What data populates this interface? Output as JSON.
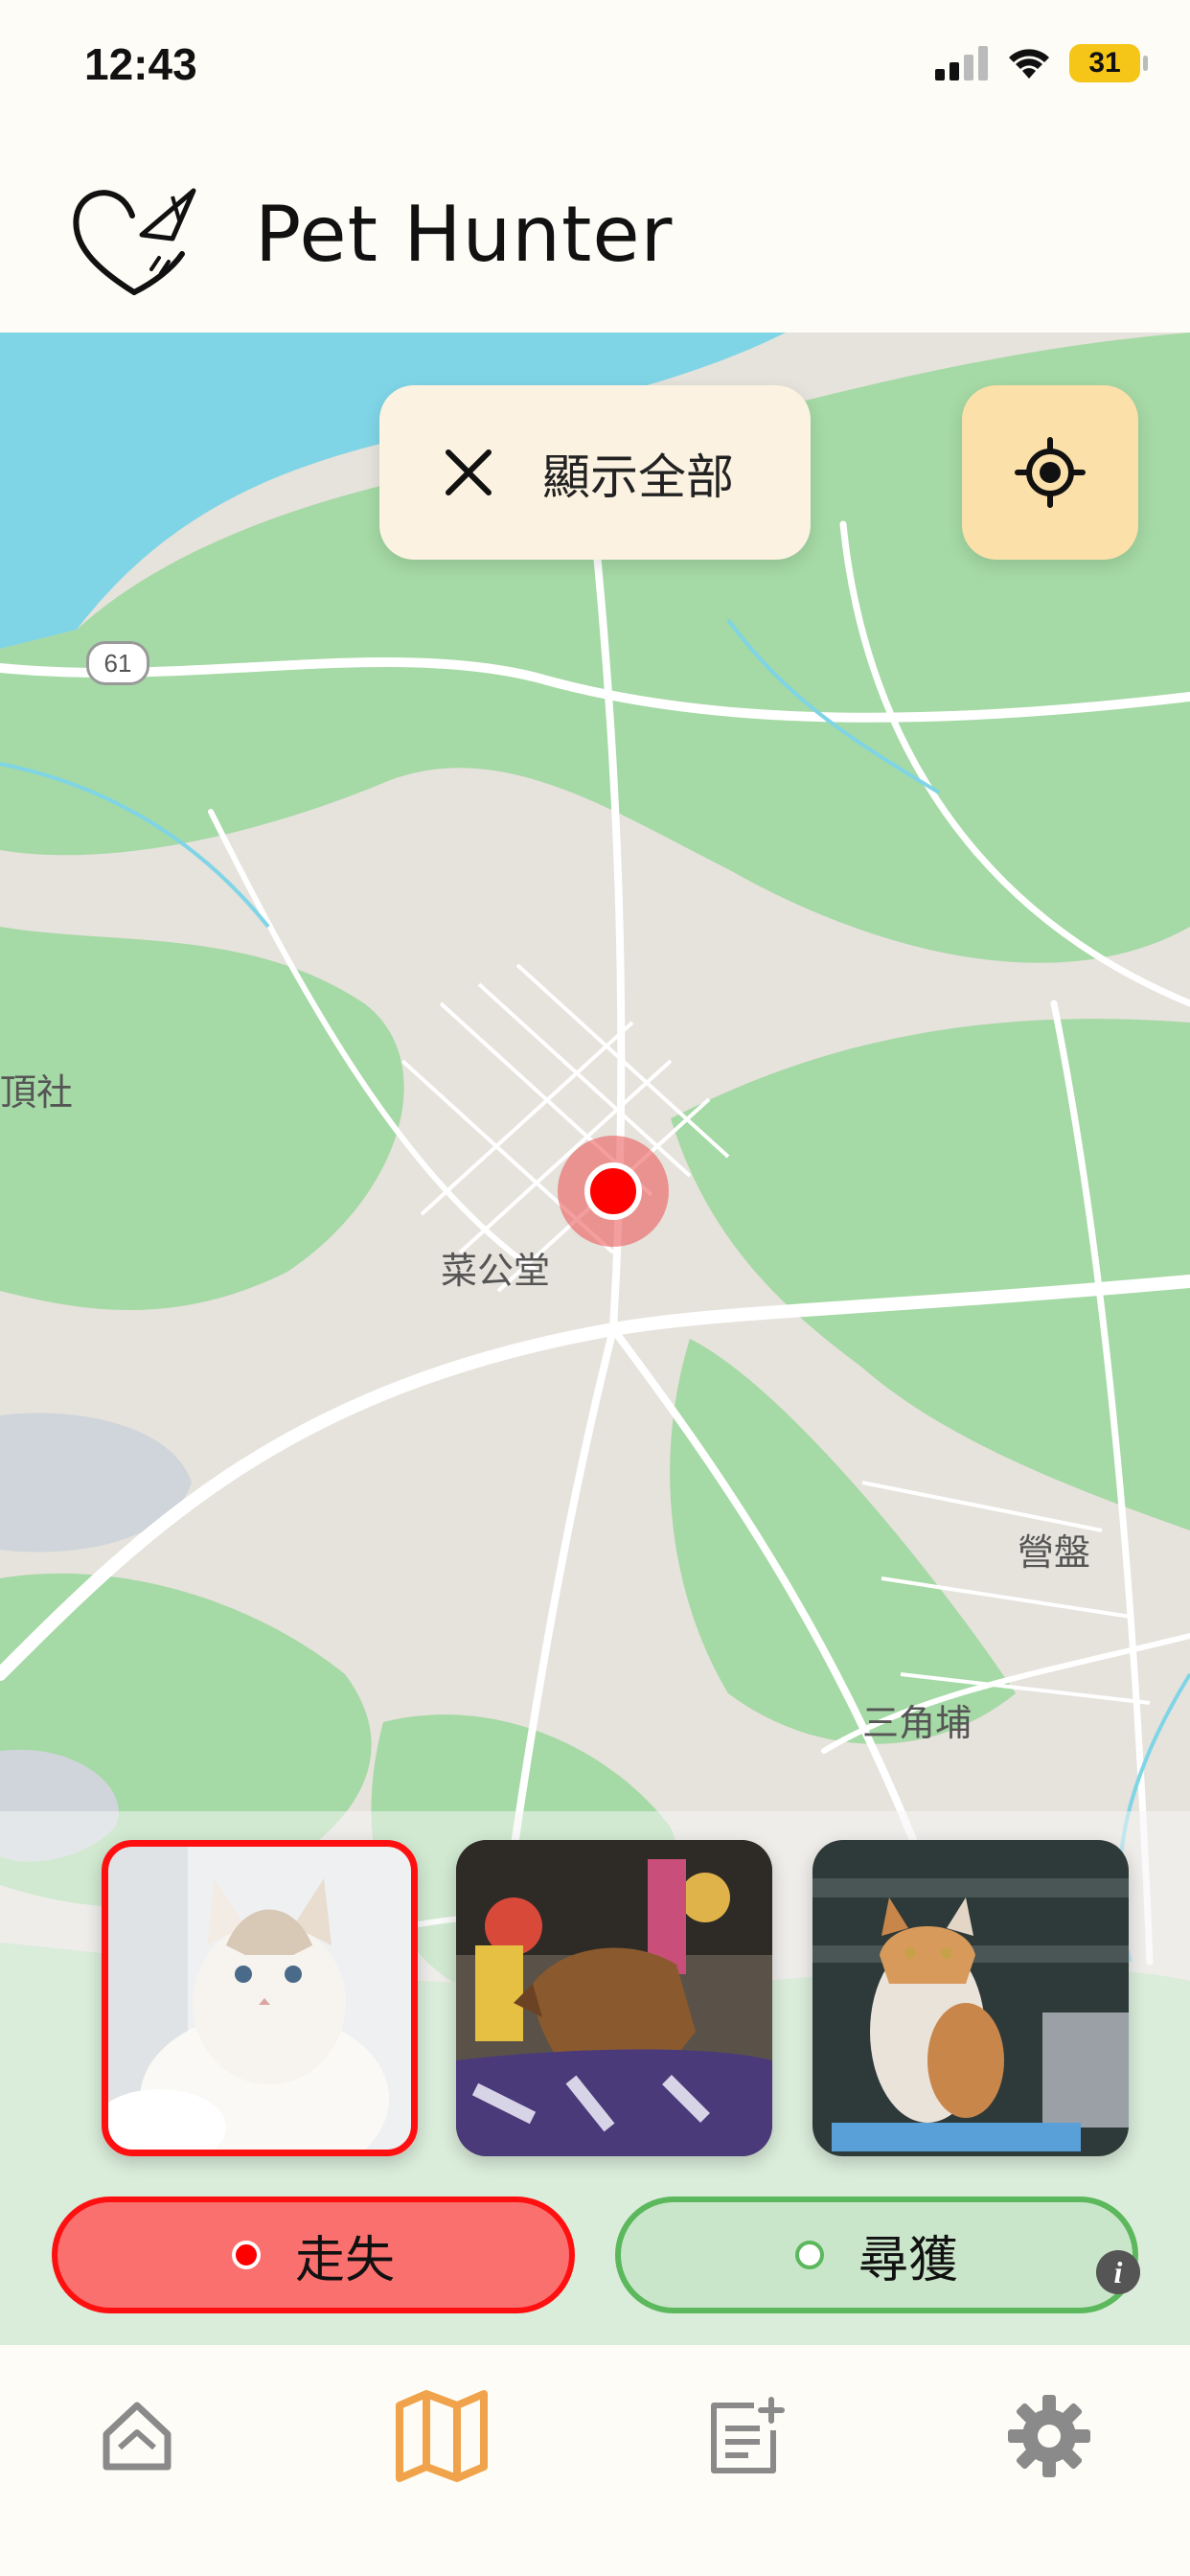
{
  "status_bar": {
    "time": "12:43",
    "battery": "31"
  },
  "header": {
    "title": "Pet Hunter",
    "logo_icon": "heart-plane-logo-icon"
  },
  "map": {
    "labels": [
      "頂社",
      "菜公堂",
      "營盤",
      "三角埔"
    ],
    "road_badge": "61"
  },
  "filter_chip": {
    "label": "顯示全部",
    "icon": "close-icon"
  },
  "locate_button": {
    "icon": "crosshair-icon"
  },
  "pets": [
    {
      "name": "white-cat-photo",
      "selected": true
    },
    {
      "name": "brown-dog-photo",
      "selected": false
    },
    {
      "name": "calico-cat-photo",
      "selected": false
    }
  ],
  "toggles": {
    "lost": {
      "label": "走失",
      "color": "#ff1010"
    },
    "found": {
      "label": "尋獲",
      "color": "#5cb85c"
    }
  },
  "tabs": [
    {
      "name": "tab-home",
      "icon": "home-icon",
      "active": false
    },
    {
      "name": "tab-map",
      "icon": "map-icon",
      "active": true,
      "color": "#f0a34a"
    },
    {
      "name": "tab-posts",
      "icon": "add-note-icon",
      "active": false
    },
    {
      "name": "tab-settings",
      "icon": "gear-icon",
      "active": false
    }
  ]
}
